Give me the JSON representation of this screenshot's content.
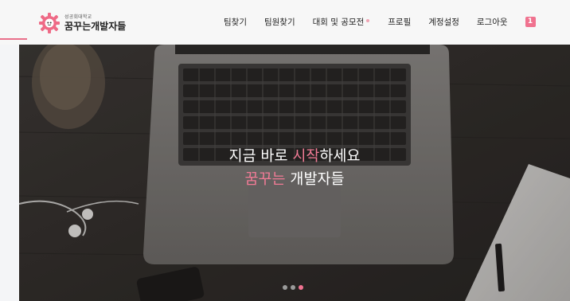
{
  "header": {
    "logo": {
      "subtitle": "성공회대학교",
      "title": "꿈꾸는개발자들"
    },
    "nav": [
      {
        "label": "팀찾기"
      },
      {
        "label": "팀원찾기"
      },
      {
        "label": "대회 및 공모전"
      },
      {
        "label": "프로필"
      },
      {
        "label": "계정설정"
      },
      {
        "label": "로그아웃"
      }
    ],
    "notification_count": "1"
  },
  "hero": {
    "line1_pre": "지금 바로 ",
    "line1_accent": "시작",
    "line1_post": "하세요",
    "line2_accent": "꿈꾸는",
    "line2_post": " 개발자들",
    "slide_count": 3,
    "active_slide": 3
  },
  "colors": {
    "accent": "#f27b96",
    "side_line": "#e9708b",
    "badge": "#f0728f",
    "header_bg": "#f7f7f7"
  }
}
